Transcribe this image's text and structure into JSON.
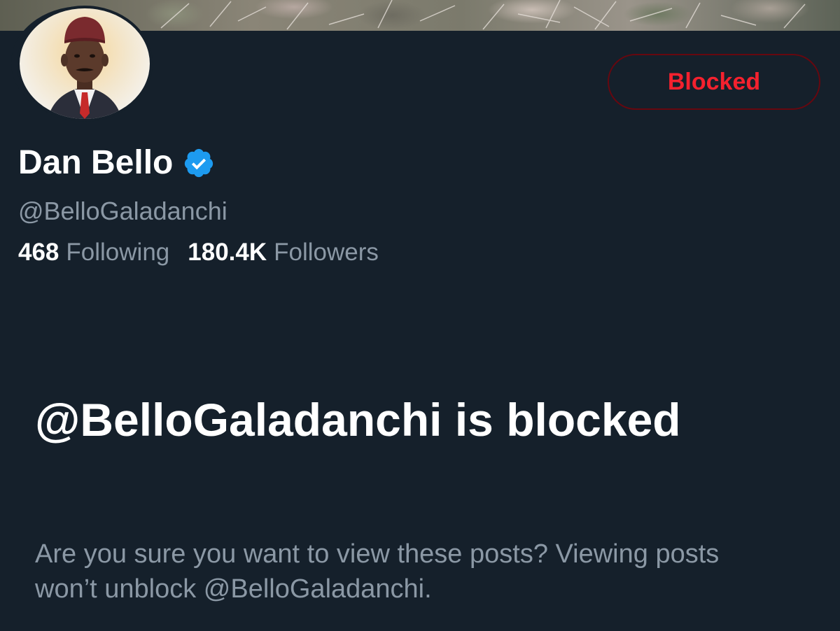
{
  "profile": {
    "display_name": "Dan Bello",
    "handle": "@BelloGaladanchi",
    "verified": true,
    "verified_icon": "verified-badge-icon"
  },
  "actions": {
    "blocked_label": "Blocked"
  },
  "stats": {
    "following_count": "468",
    "following_label": "Following",
    "followers_count": "180.4K",
    "followers_label": "Followers"
  },
  "blocked_notice": {
    "title": "@BelloGaladanchi is blocked",
    "description": "Are you sure you want to view these posts? Viewing posts won’t unblock @BelloGaladanchi."
  },
  "colors": {
    "background": "#15202b",
    "blocked_red": "#f4212e",
    "blocked_border": "#67070f",
    "verified_blue": "#1d9bf0",
    "secondary_text": "#8b98a5"
  }
}
